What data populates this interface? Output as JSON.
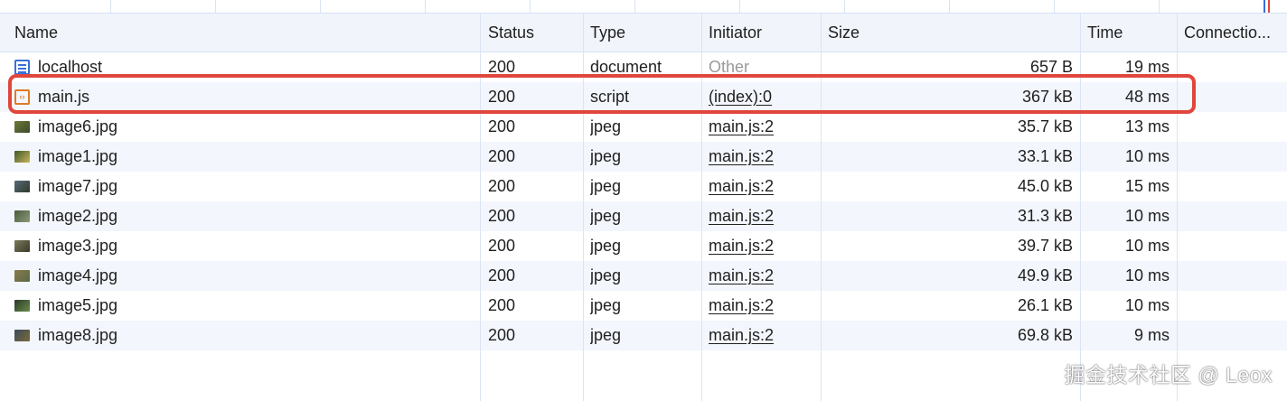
{
  "columns": {
    "name": "Name",
    "status": "Status",
    "type": "Type",
    "initiator": "Initiator",
    "size": "Size",
    "time": "Time",
    "connection": "Connectio..."
  },
  "rows": [
    {
      "name": "localhost",
      "status": "200",
      "type": "document",
      "initiator": "Other",
      "size": "657 B",
      "time": "19 ms",
      "icon": "document-icon"
    },
    {
      "name": "main.js",
      "status": "200",
      "type": "script",
      "initiator": "(index):0",
      "size": "367 kB",
      "time": "48 ms",
      "icon": "script-icon"
    },
    {
      "name": "image6.jpg",
      "status": "200",
      "type": "jpeg",
      "initiator": "main.js:2",
      "size": "35.7 kB",
      "time": "13 ms",
      "icon": "image-thumbnail-icon"
    },
    {
      "name": "image1.jpg",
      "status": "200",
      "type": "jpeg",
      "initiator": "main.js:2",
      "size": "33.1 kB",
      "time": "10 ms",
      "icon": "image-thumbnail-icon"
    },
    {
      "name": "image7.jpg",
      "status": "200",
      "type": "jpeg",
      "initiator": "main.js:2",
      "size": "45.0 kB",
      "time": "15 ms",
      "icon": "image-thumbnail-icon"
    },
    {
      "name": "image2.jpg",
      "status": "200",
      "type": "jpeg",
      "initiator": "main.js:2",
      "size": "31.3 kB",
      "time": "10 ms",
      "icon": "image-thumbnail-icon"
    },
    {
      "name": "image3.jpg",
      "status": "200",
      "type": "jpeg",
      "initiator": "main.js:2",
      "size": "39.7 kB",
      "time": "10 ms",
      "icon": "image-thumbnail-icon"
    },
    {
      "name": "image4.jpg",
      "status": "200",
      "type": "jpeg",
      "initiator": "main.js:2",
      "size": "49.9 kB",
      "time": "10 ms",
      "icon": "image-thumbnail-icon"
    },
    {
      "name": "image5.jpg",
      "status": "200",
      "type": "jpeg",
      "initiator": "main.js:2",
      "size": "26.1 kB",
      "time": "10 ms",
      "icon": "image-thumbnail-icon"
    },
    {
      "name": "image8.jpg",
      "status": "200",
      "type": "jpeg",
      "initiator": "main.js:2",
      "size": "69.8 kB",
      "time": "9 ms",
      "icon": "image-thumbnail-icon"
    }
  ],
  "highlighted_row": "main.js",
  "colors": {
    "highlight_border": "#e0463c",
    "header_bg": "#f1f4fb",
    "alt_row_bg": "#f3f6fc",
    "document_icon": "#3a6fd8",
    "script_icon": "#e07a26"
  },
  "watermark": "掘金技术社区 @ Leox"
}
